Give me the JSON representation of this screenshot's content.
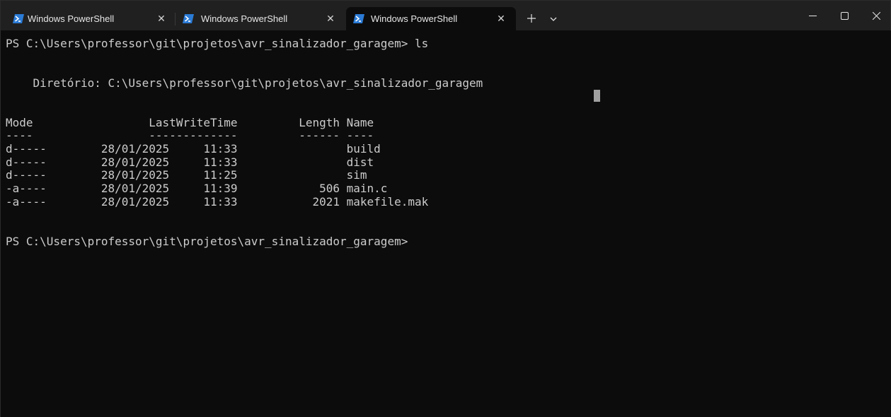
{
  "tabs": [
    {
      "title": "Windows PowerShell",
      "active": false
    },
    {
      "title": "Windows PowerShell",
      "active": false
    },
    {
      "title": "Windows PowerShell",
      "active": true
    }
  ],
  "icons": {
    "tab": "powershell-icon",
    "close": "close-icon",
    "new_tab": "plus-icon",
    "dropdown": "chevron-down-icon",
    "minimize": "minimize-icon",
    "maximize": "maximize-icon",
    "window_close": "close-icon"
  },
  "terminal": {
    "lines": [
      "PS C:\\Users\\professor\\git\\projetos\\avr_sinalizador_garagem> ls",
      "",
      "",
      "    Diretório: C:\\Users\\professor\\git\\projetos\\avr_sinalizador_garagem",
      "",
      "",
      "Mode                 LastWriteTime         Length Name",
      "----                 -------------         ------ ----",
      "d-----        28/01/2025     11:33                build",
      "d-----        28/01/2025     11:33                dist",
      "d-----        28/01/2025     11:25                sim",
      "-a----        28/01/2025     11:39            506 main.c",
      "-a----        28/01/2025     11:33           2021 makefile.mak",
      "",
      "",
      "PS C:\\Users\\professor\\git\\projetos\\avr_sinalizador_garagem>"
    ]
  },
  "colors": {
    "terminal_bg": "#0c0c0c",
    "titlebar_bg": "#202020",
    "text": "#cccccc",
    "icon_blue": "#2b7bd6"
  }
}
